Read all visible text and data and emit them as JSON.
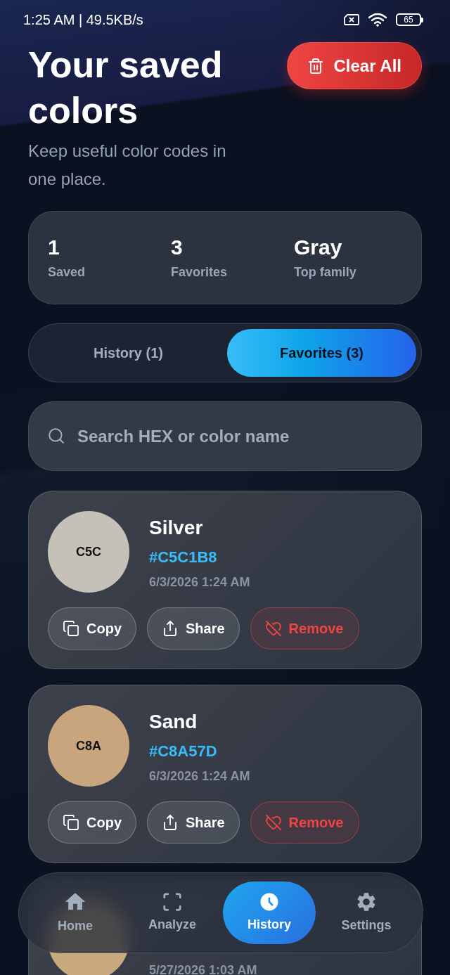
{
  "status_bar": {
    "time_speed": "1:25 AM | 49.5KB/s",
    "battery": "65"
  },
  "header": {
    "title": "Your saved colors",
    "subtitle": "Keep useful color codes in one place.",
    "clear_button": "Clear All"
  },
  "stats": [
    {
      "value": "1",
      "label": "Saved"
    },
    {
      "value": "3",
      "label": "Favorites"
    },
    {
      "value": "Gray",
      "label": "Top family"
    }
  ],
  "tabs": [
    {
      "label": "History (1)",
      "selected": false
    },
    {
      "label": "Favorites (3)",
      "selected": true
    }
  ],
  "search": {
    "placeholder": "Search HEX or color name"
  },
  "colors": [
    {
      "name": "Silver",
      "hex": "#C5C1B8",
      "swatch_label": "C5C",
      "color": "#c5c1b8",
      "date": "6/3/2026 1:24 AM",
      "actions": [
        {
          "kind": "copy",
          "label": "Copy"
        },
        {
          "kind": "share",
          "label": "Share"
        },
        {
          "kind": "remove",
          "label": "Remove"
        }
      ]
    },
    {
      "name": "Sand",
      "hex": "#C8A57D",
      "swatch_label": "C8A",
      "color": "#c8a57d",
      "date": "6/3/2026 1:24 AM",
      "actions": [
        {
          "kind": "copy",
          "label": "Copy"
        },
        {
          "kind": "share",
          "label": "Share"
        },
        {
          "kind": "remove",
          "label": "Remove"
        }
      ]
    },
    {
      "color": "#c9a97e",
      "date": "5/27/2026 1:03 AM"
    }
  ],
  "nav": [
    {
      "label": "Home",
      "selected": false
    },
    {
      "label": "Analyze",
      "selected": false
    },
    {
      "label": "History",
      "selected": true
    },
    {
      "label": "Settings",
      "selected": false
    }
  ]
}
